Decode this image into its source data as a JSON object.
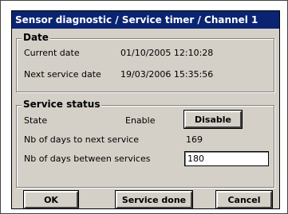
{
  "window": {
    "title": "Sensor diagnostic / Service timer / Channel 1"
  },
  "date_group": {
    "legend": "Date",
    "current_date_label": "Current date",
    "current_date_value": "01/10/2005 12:10:28",
    "next_service_date_label": "Next service date",
    "next_service_date_value": "19/03/2006 15:35:56"
  },
  "service_group": {
    "legend": "Service status",
    "state_label": "State",
    "state_value": "Enable",
    "toggle_button_label": "Disable",
    "days_to_next_label": "Nb of days to next service",
    "days_to_next_value": "169",
    "days_between_label": "Nb of days between services",
    "days_between_value": "180"
  },
  "buttons": {
    "ok_label": "OK",
    "service_done_label": "Service done",
    "cancel_label": "Cancel"
  },
  "colors": {
    "titlebar": "#0a2472",
    "face": "#d4d0c8"
  }
}
